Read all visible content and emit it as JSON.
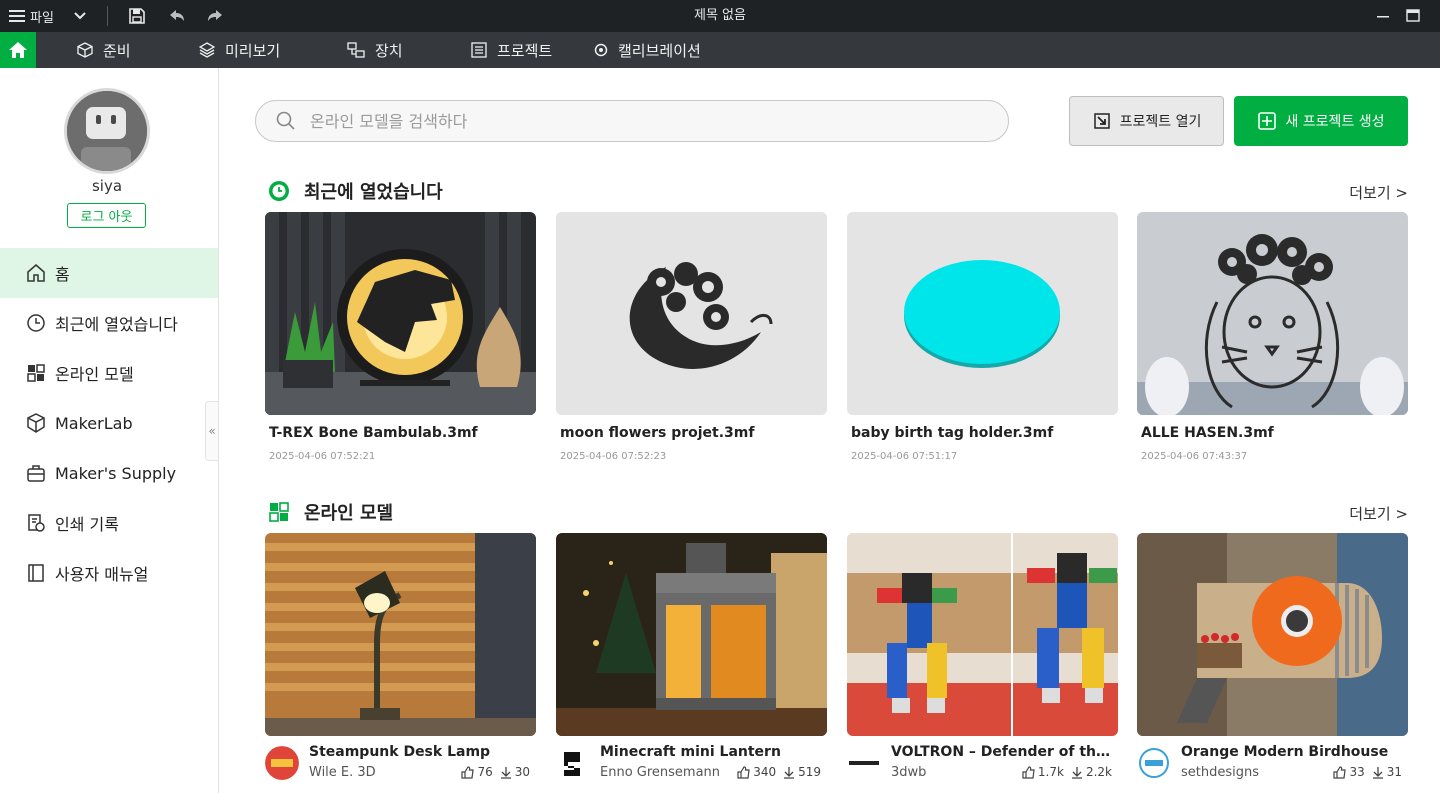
{
  "titlebar": {
    "menu_label": "파일",
    "window_title": "제목 없음"
  },
  "nav": {
    "tabs": [
      {
        "label": "준비"
      },
      {
        "label": "미리보기"
      },
      {
        "label": "장치"
      },
      {
        "label": "프로젝트"
      },
      {
        "label": "캘리브레이션"
      }
    ]
  },
  "sidebar": {
    "username": "siya",
    "logout_label": "로그 아웃",
    "items": [
      {
        "label": "홈"
      },
      {
        "label": "최근에 열었습니다"
      },
      {
        "label": "온라인 모델"
      },
      {
        "label": "MakerLab"
      },
      {
        "label": "Maker's Supply"
      },
      {
        "label": "인쇄 기록"
      },
      {
        "label": "사용자 매뉴얼"
      }
    ]
  },
  "search": {
    "placeholder": "온라인 모델을 검색하다"
  },
  "actions": {
    "open_project": "프로젝트 열기",
    "new_project": "새 프로젝트 생성"
  },
  "recent": {
    "title": "최근에 열었습니다",
    "more": "더보기 >",
    "items": [
      {
        "name": "T-REX Bone Bambulab.3mf",
        "date": "2025-04-06 07:52:21"
      },
      {
        "name": "moon flowers projet.3mf",
        "date": "2025-04-06 07:52:23"
      },
      {
        "name": "baby birth tag holder.3mf",
        "date": "2025-04-06 07:51:17"
      },
      {
        "name": "ALLE HASEN.3mf",
        "date": "2025-04-06 07:43:37"
      }
    ]
  },
  "online": {
    "title": "온라인 모델",
    "more": "더보기 >",
    "items": [
      {
        "name": "Steampunk Desk Lamp",
        "author": "Wile E. 3D",
        "likes": "76",
        "downloads": "30"
      },
      {
        "name": "Minecraft mini Lantern",
        "author": "Enno Grensemann",
        "likes": "340",
        "downloads": "519"
      },
      {
        "name": "VOLTRON – Defender of the U...",
        "author": "3dwb",
        "likes": "1.7k",
        "downloads": "2.2k"
      },
      {
        "name": "Orange Modern Birdhouse",
        "author": "sethdesigns",
        "likes": "33",
        "downloads": "31"
      }
    ]
  },
  "colors": {
    "accent": "#00ae42",
    "titlebar": "#1f2225",
    "navbar": "#35393d"
  }
}
